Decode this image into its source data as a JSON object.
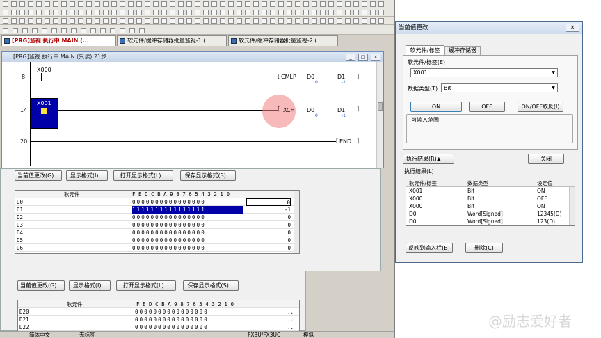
{
  "main_tabs": [
    {
      "label": "[PRG]监视 执行中 MAIN (..."
    },
    {
      "label": "软元件/缓冲存储器批量监视-1 (..."
    },
    {
      "label": "软元件/缓冲存储器批量监视-2 (..."
    }
  ],
  "ladder_window": {
    "title": "[PRG]监视 执行中 MAIN (只读) 21步",
    "rungs": [
      {
        "step": "8",
        "contact": "X000",
        "instr": "CMLP",
        "op1": "D0",
        "op1_val": "0",
        "op2": "D1",
        "op2_val": "-1"
      },
      {
        "step": "14",
        "contact": "X001",
        "instr": "XCH",
        "op1": "D0",
        "op1_val": "0",
        "op2": "D1",
        "op2_val": "-1"
      },
      {
        "step": "20",
        "instr": "END"
      }
    ]
  },
  "monitor1": {
    "buttons": [
      "当前值更改(G)...",
      "显示格式(I)...",
      "打开显示格式(L)...",
      "保存显示格式(S)..."
    ],
    "col_device": "软元件",
    "col_bits": "F E D C B A 9 8 7 6 5 4 3 2 1 0",
    "rows": [
      {
        "device": "D0",
        "bits": "0000000000000000",
        "value": "0",
        "highlight": false
      },
      {
        "device": "D1",
        "bits": "1111111111111111",
        "value": "-1",
        "highlight": true
      },
      {
        "device": "D2",
        "bits": "0000000000000000",
        "value": "0",
        "highlight": false
      },
      {
        "device": "D3",
        "bits": "0000000000000000",
        "value": "0",
        "highlight": false
      },
      {
        "device": "D4",
        "bits": "0000000000000000",
        "value": "0",
        "highlight": false
      },
      {
        "device": "D5",
        "bits": "0000000000000000",
        "value": "0",
        "highlight": false
      },
      {
        "device": "D6",
        "bits": "0000000000000000",
        "value": "0",
        "highlight": false
      }
    ]
  },
  "monitor2": {
    "buttons": [
      "当前值更改(G)...",
      "显示格式(I)...",
      "打开显示格式(L)...",
      "保存显示格式(S)..."
    ],
    "col_device": "软元件",
    "col_bits": "F E D C B A 9 8 7 6 5 4 3 2 1 0",
    "rows": [
      {
        "device": "D20",
        "bits": "0000000000000000",
        "value": ".."
      },
      {
        "device": "D21",
        "bits": "0000000000000000",
        "value": ".."
      },
      {
        "device": "D22",
        "bits": "0000000000000000",
        "value": ".."
      }
    ]
  },
  "status_bar": {
    "items": [
      "简体中文",
      "无标签",
      "FX3U/FX3UC",
      "模拟"
    ]
  },
  "dialog": {
    "title": "当前值更改",
    "tabs": [
      "软元件/标签",
      "缓冲存储器"
    ],
    "device_label": "软元件/标签(E)",
    "device_value": "X001",
    "dtype_label": "数据类型(T)",
    "dtype_value": "Bit",
    "btn_on": "ON",
    "btn_off": "OFF",
    "btn_toggle": "ON/OFF取反(I)",
    "range_label": "可输入范围",
    "btn_exec_result": "执行结果(R)▲",
    "btn_close": "关闭",
    "result_label": "执行结果(L)",
    "result_headers": [
      "软元件/标签",
      "数据类型",
      "设定值"
    ],
    "result_rows": [
      {
        "device": "X001",
        "type": "Bit",
        "value": "ON"
      },
      {
        "device": "X000",
        "type": "Bit",
        "value": "OFF"
      },
      {
        "device": "X000",
        "type": "Bit",
        "value": "ON"
      },
      {
        "device": "D0",
        "type": "Word[Signed]",
        "value": "12345(D)"
      },
      {
        "device": "D0",
        "type": "Word[Signed]",
        "value": "123(D)"
      }
    ],
    "btn_reflect": "反映到输入栏(B)",
    "btn_delete": "删除(C)"
  },
  "watermark": "@励志爱好者",
  "colors": {
    "highlight": "#0000a8",
    "accent_red": "#b00000",
    "cursor": "#f08080"
  }
}
